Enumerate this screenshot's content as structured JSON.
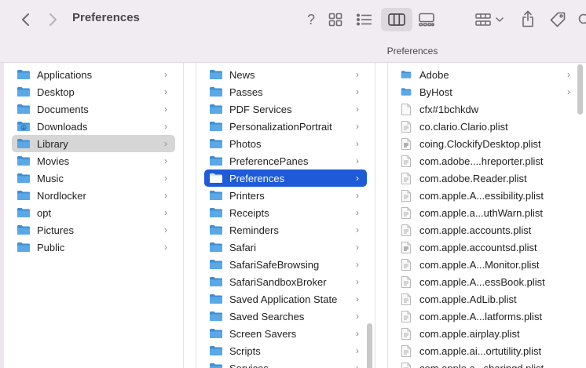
{
  "window": {
    "title": "Preferences",
    "path_title": "Preferences"
  },
  "toolbar": {
    "back_icon": "chevron-left-icon",
    "forward_icon": "chevron-right-icon",
    "help_label": "?",
    "view_modes": [
      "icons",
      "list",
      "columns",
      "gallery"
    ],
    "active_view": "columns"
  },
  "columns": [
    {
      "items": [
        {
          "label": "Applications",
          "icon": "folder",
          "chevron": true
        },
        {
          "label": "Desktop",
          "icon": "folder",
          "chevron": true
        },
        {
          "label": "Documents",
          "icon": "folder",
          "chevron": true
        },
        {
          "label": "Downloads",
          "icon": "folder-downloads",
          "chevron": true
        },
        {
          "label": "Library",
          "icon": "folder",
          "chevron": true,
          "selected": "gray"
        },
        {
          "label": "Movies",
          "icon": "folder",
          "chevron": true
        },
        {
          "label": "Music",
          "icon": "folder",
          "chevron": true
        },
        {
          "label": "Nordlocker",
          "icon": "folder",
          "chevron": true
        },
        {
          "label": "opt",
          "icon": "folder",
          "chevron": true
        },
        {
          "label": "Pictures",
          "icon": "folder",
          "chevron": true
        },
        {
          "label": "Public",
          "icon": "folder",
          "chevron": true
        }
      ]
    },
    {
      "items": [
        {
          "label": "News",
          "icon": "folder",
          "chevron": true
        },
        {
          "label": "Passes",
          "icon": "folder",
          "chevron": true
        },
        {
          "label": "PDF Services",
          "icon": "folder",
          "chevron": true
        },
        {
          "label": "PersonalizationPortrait",
          "icon": "folder",
          "chevron": true
        },
        {
          "label": "Photos",
          "icon": "folder",
          "chevron": true
        },
        {
          "label": "PreferencePanes",
          "icon": "folder",
          "chevron": true
        },
        {
          "label": "Preferences",
          "icon": "folder",
          "chevron": true,
          "selected": "blue"
        },
        {
          "label": "Printers",
          "icon": "folder",
          "chevron": true
        },
        {
          "label": "Receipts",
          "icon": "folder",
          "chevron": true
        },
        {
          "label": "Reminders",
          "icon": "folder",
          "chevron": true
        },
        {
          "label": "Safari",
          "icon": "folder",
          "chevron": true
        },
        {
          "label": "SafariSafeBrowsing",
          "icon": "folder",
          "chevron": true
        },
        {
          "label": "SafariSandboxBroker",
          "icon": "folder",
          "chevron": true
        },
        {
          "label": "Saved Application State",
          "icon": "folder",
          "chevron": true
        },
        {
          "label": "Saved Searches",
          "icon": "folder",
          "chevron": true
        },
        {
          "label": "Screen Savers",
          "icon": "folder",
          "chevron": true
        },
        {
          "label": "Scripts",
          "icon": "folder",
          "chevron": true
        },
        {
          "label": "Services",
          "icon": "folder",
          "chevron": true
        }
      ]
    },
    {
      "items": [
        {
          "label": "Adobe",
          "icon": "folder",
          "chevron": true
        },
        {
          "label": "ByHost",
          "icon": "folder",
          "chevron": true
        },
        {
          "label": "cfx#1bchkdw",
          "icon": "file-blank",
          "chevron": false
        },
        {
          "label": "co.clario.Clario.plist",
          "icon": "file-plist",
          "chevron": false
        },
        {
          "label": "coing.ClockifyDesktop.plist",
          "icon": "file-plist-dark",
          "chevron": false
        },
        {
          "label": "com.adobe....hreporter.plist",
          "icon": "file-plist",
          "chevron": false
        },
        {
          "label": "com.adobe.Reader.plist",
          "icon": "file-plist",
          "chevron": false
        },
        {
          "label": "com.apple.A...essibility.plist",
          "icon": "file-plist",
          "chevron": false
        },
        {
          "label": "com.apple.a...uthWarn.plist",
          "icon": "file-plist",
          "chevron": false
        },
        {
          "label": "com.apple.accounts.plist",
          "icon": "file-plist",
          "chevron": false
        },
        {
          "label": "com.apple.accountsd.plist",
          "icon": "file-plist-dark",
          "chevron": false
        },
        {
          "label": "com.apple.A...Monitor.plist",
          "icon": "file-plist",
          "chevron": false
        },
        {
          "label": "com.apple.A...essBook.plist",
          "icon": "file-plist",
          "chevron": false
        },
        {
          "label": "com.apple.AdLib.plist",
          "icon": "file-plist",
          "chevron": false
        },
        {
          "label": "com.apple.A...latforms.plist",
          "icon": "file-plist",
          "chevron": false
        },
        {
          "label": "com.apple.airplay.plist",
          "icon": "file-plist",
          "chevron": false
        },
        {
          "label": "com.apple.ai...ortutility.plist",
          "icon": "file-plist",
          "chevron": false
        },
        {
          "label": "com.apple.a...sharingd.plist",
          "icon": "file-plist",
          "chevron": false
        }
      ]
    }
  ],
  "colors": {
    "toolbar_bg": "#f1ecf2",
    "folder_blue": "#5aa8e6",
    "selection_blue": "#1f5bd8",
    "selection_gray": "#d6d6d6"
  }
}
